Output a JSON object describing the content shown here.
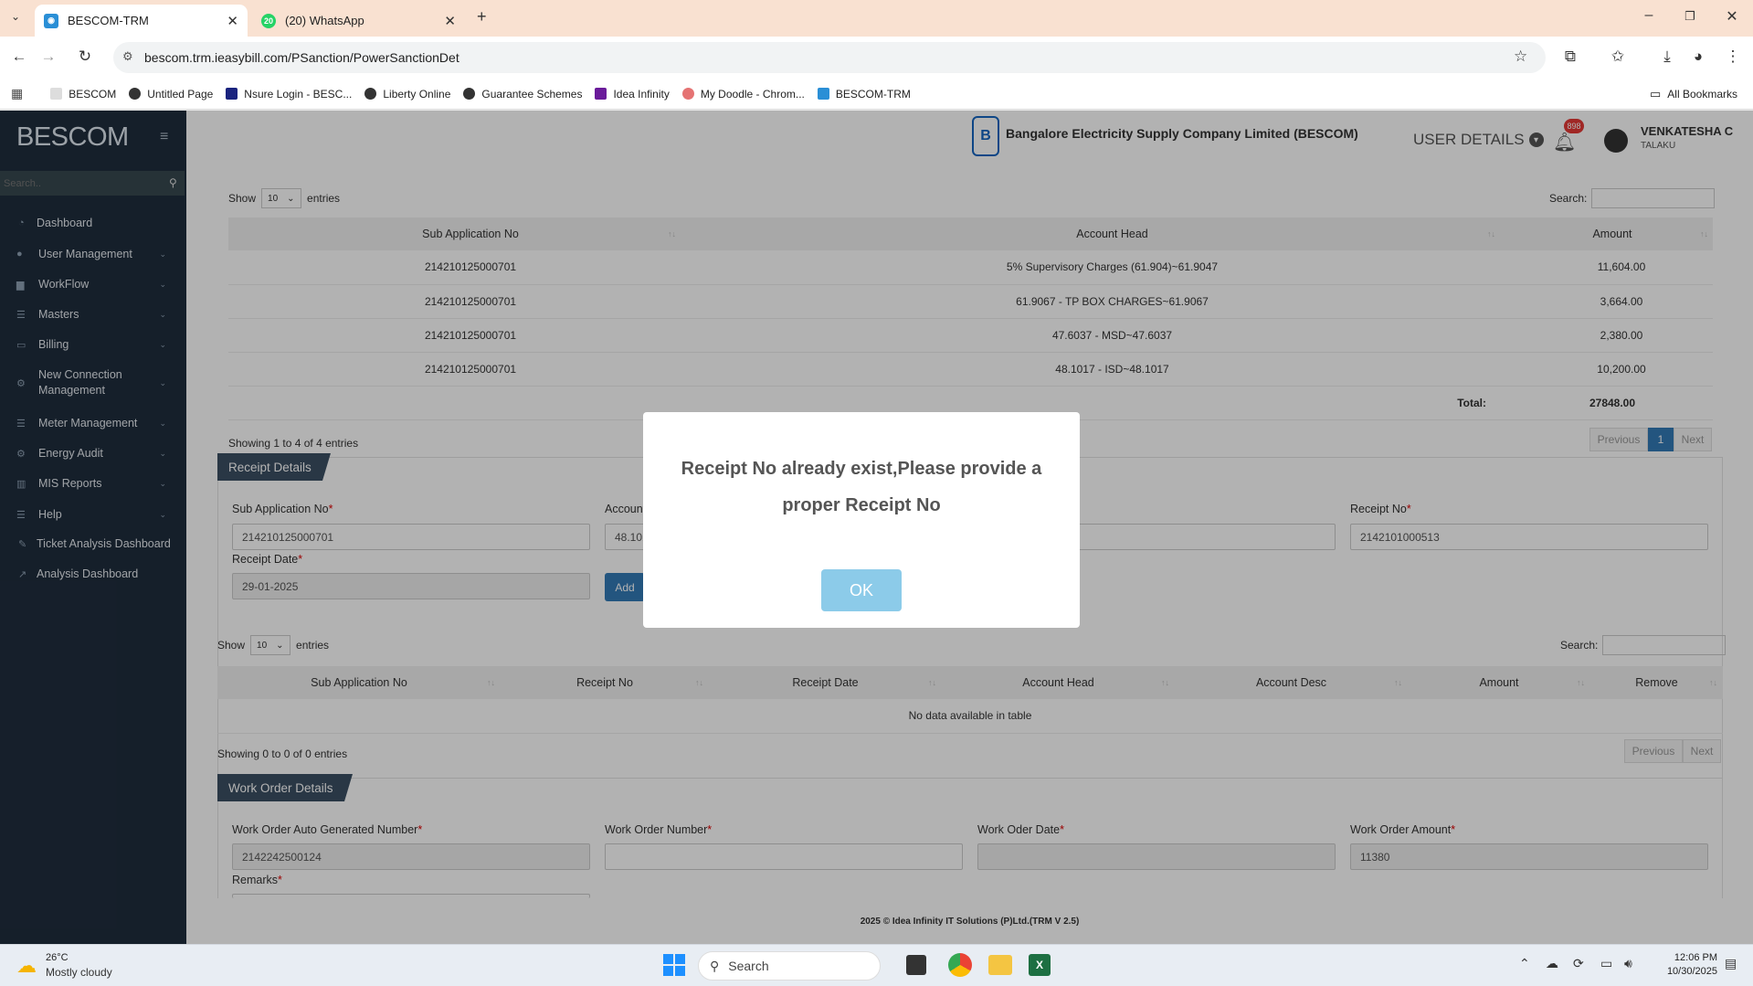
{
  "browser": {
    "tabs": [
      {
        "title": "BESCOM-TRM",
        "active": true
      },
      {
        "title": "(20) WhatsApp",
        "active": false,
        "badge": "20"
      }
    ],
    "url": "bescom.trm.ieasybill.com/PSanction/PowerSanctionDet",
    "bookmarks": [
      "BESCOM",
      "Untitled Page",
      "Nsure Login - BESC...",
      "Liberty Online",
      "Guarantee Schemes",
      "Idea Infinity",
      "My Doodle - Chrom...",
      "BESCOM-TRM"
    ],
    "all_bookmarks": "All Bookmarks"
  },
  "sidebar": {
    "logo": "BESCOM",
    "search_placeholder": "Search..",
    "items": [
      {
        "label": "Dashboard",
        "icon": "dashboard-icon",
        "glyph": "◔",
        "expandable": false
      },
      {
        "label": "User Management",
        "icon": "user-icon",
        "glyph": "●",
        "expandable": true
      },
      {
        "label": "WorkFlow",
        "icon": "workflow-icon",
        "glyph": "▆",
        "expandable": true
      },
      {
        "label": "Masters",
        "icon": "list-icon",
        "glyph": "☰",
        "expandable": true
      },
      {
        "label": "Billing",
        "icon": "monitor-icon",
        "glyph": "▭",
        "expandable": true
      },
      {
        "label": "New Connection Management",
        "icon": "connection-icon",
        "glyph": "⚙",
        "expandable": true
      },
      {
        "label": "Meter Management",
        "icon": "meter-icon",
        "glyph": "☰",
        "expandable": true
      },
      {
        "label": "Energy Audit",
        "icon": "audit-icon",
        "glyph": "⚙",
        "expandable": true
      },
      {
        "label": "MIS Reports",
        "icon": "bar-chart-icon",
        "glyph": "▥",
        "expandable": true
      },
      {
        "label": "Help",
        "icon": "help-icon",
        "glyph": "☰",
        "expandable": true
      },
      {
        "label": "Ticket Analysis Dashboard",
        "icon": "ticket-icon",
        "glyph": "✎",
        "expandable": false
      },
      {
        "label": "Analysis Dashboard",
        "icon": "line-chart-icon",
        "glyph": "↗",
        "expandable": false
      }
    ]
  },
  "header": {
    "company": "Bangalore Electricity Supply Company Limited (BESCOM)",
    "user_details": "USER DETAILS",
    "notification_count": "898",
    "user_name": "VENKATESHA C",
    "user_role": "TALAKU"
  },
  "account_table": {
    "show_label": "Show",
    "entries_value": "10",
    "entries_label": "entries",
    "search_label": "Search:",
    "columns": [
      "Sub Application No",
      "Account Head",
      "Amount"
    ],
    "rows": [
      [
        "214210125000701",
        "5% Supervisory Charges (61.904)~61.9047",
        "11,604.00"
      ],
      [
        "214210125000701",
        "61.9067 - TP BOX CHARGES~61.9067",
        "3,664.00"
      ],
      [
        "214210125000701",
        "47.6037 - MSD~47.6037",
        "2,380.00"
      ],
      [
        "214210125000701",
        "48.1017 - ISD~48.1017",
        "10,200.00"
      ]
    ],
    "total_label": "Total:",
    "total_value": "27848.00",
    "info": "Showing 1 to 4 of 4 entries",
    "prev": "Previous",
    "page": "1",
    "next": "Next"
  },
  "receipt": {
    "title": "Receipt Details",
    "sub_app_label": "Sub Application No",
    "sub_app_value": "214210125000701",
    "account_label": "Account",
    "account_value": "48.101",
    "receipt_no_label": "Receipt No",
    "receipt_no_value": "2142101000513",
    "receipt_date_label": "Receipt Date",
    "receipt_date_value": "29-01-2025",
    "add_label": "Add"
  },
  "receipt_table": {
    "show_label": "Show",
    "entries_value": "10",
    "entries_label": "entries",
    "search_label": "Search:",
    "columns": [
      "Sub Application No",
      "Receipt No",
      "Receipt Date",
      "Account Head",
      "Account Desc",
      "Amount",
      "Remove"
    ],
    "empty": "No data available in table",
    "info": "Showing 0 to 0 of 0 entries",
    "prev": "Previous",
    "next": "Next"
  },
  "work_order": {
    "title": "Work Order Details",
    "auto_no_label": "Work Order Auto Generated Number",
    "auto_no_value": "2142242500124",
    "number_label": "Work Order Number",
    "number_value": "",
    "date_label": "Work Oder Date",
    "date_value": "",
    "amount_label": "Work Order Amount",
    "amount_value": "11380",
    "remarks_label": "Remarks"
  },
  "footer": "2025 © Idea Infinity IT Solutions (P)Ltd.(TRM V 2.5)",
  "modal": {
    "message": "Receipt No already exist,Please provide a proper Receipt No",
    "ok": "OK"
  },
  "taskbar": {
    "temperature": "26°C",
    "weather": "Mostly cloudy",
    "search": "Search",
    "time": "12:06 PM",
    "date": "10/30/2025"
  },
  "colors": {
    "sidebar": "#1f2d3d",
    "section_header": "#3c5063",
    "primary": "#337ab7",
    "ok_button": "#8ccbe9",
    "tab_bar": "#f9e1d1"
  }
}
